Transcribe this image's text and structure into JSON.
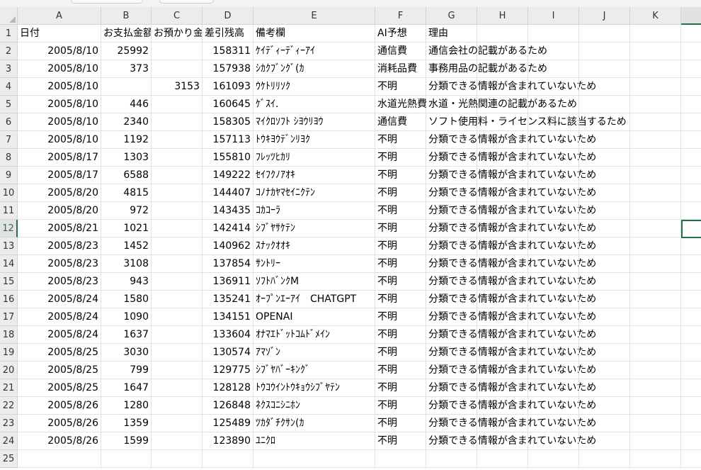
{
  "columns": [
    "A",
    "B",
    "C",
    "D",
    "E",
    "F",
    "G",
    "H",
    "I",
    "J",
    "K"
  ],
  "active_cell": "L12",
  "header_row": {
    "A": "日付",
    "B": "お支払金額",
    "C": "お預かり金額",
    "D": "差引残高",
    "E": "備考欄",
    "F": "AI予想",
    "G": "理由"
  },
  "rows": [
    {
      "a": "2005/8/10",
      "b": "25992",
      "c": "",
      "d": "158311",
      "e": "ｹｲﾃﾞｨｰﾃﾞｨｰｱｲ",
      "f": "通信費",
      "g": "通信会社の記載があるため"
    },
    {
      "a": "2005/8/10",
      "b": "373",
      "c": "",
      "d": "157938",
      "e": "ｼｶｸﾌﾞﾝｸﾞ(ｶ",
      "f": "消耗品費",
      "g": "事務用品の記載があるため"
    },
    {
      "a": "2005/8/10",
      "b": "",
      "c": "3153",
      "d": "161093",
      "e": "ｳｹﾄﾘﾘｿｸ",
      "f": "不明",
      "g": "分類できる情報が含まれていないため"
    },
    {
      "a": "2005/8/10",
      "b": "446",
      "c": "",
      "d": "160645",
      "e": "ｹﾞｽｲ.",
      "f": "水道光熱費",
      "g": "水道・光熱関連の記載があるため"
    },
    {
      "a": "2005/8/10",
      "b": "2340",
      "c": "",
      "d": "158305",
      "e": "ﾏｲｸﾛｿﾌﾄ ｼﾖｳﾘﾖｳ",
      "f": "通信費",
      "g": "ソフト使用料・ライセンス料に該当するため"
    },
    {
      "a": "2005/8/10",
      "b": "1192",
      "c": "",
      "d": "157113",
      "e": "ﾄｳｷﾖｳﾃﾞﾝﾘﾖｸ",
      "f": "不明",
      "g": "分類できる情報が含まれていないため"
    },
    {
      "a": "2005/8/17",
      "b": "1303",
      "c": "",
      "d": "155810",
      "e": "ﾌﾚｯﾂﾋｶﾘ",
      "f": "不明",
      "g": "分類できる情報が含まれていないため"
    },
    {
      "a": "2005/8/17",
      "b": "6588",
      "c": "",
      "d": "149222",
      "e": "ｾｲﾌｸﾉｱｵｷ",
      "f": "不明",
      "g": "分類できる情報が含まれていないため"
    },
    {
      "a": "2005/8/20",
      "b": "4815",
      "c": "",
      "d": "144407",
      "e": "ｺﾉﾅｶﾔﾏｾｲﾆｸﾃﾝ",
      "f": "不明",
      "g": "分類できる情報が含まれていないため"
    },
    {
      "a": "2005/8/20",
      "b": "972",
      "c": "",
      "d": "143435",
      "e": "ｺｶｺｰﾗ",
      "f": "不明",
      "g": "分類できる情報が含まれていないため"
    },
    {
      "a": "2005/8/21",
      "b": "1021",
      "c": "",
      "d": "142414",
      "e": "ｼﾌﾞﾔｻｹﾃﾝ",
      "f": "不明",
      "g": "分類できる情報が含まれていないため"
    },
    {
      "a": "2005/8/23",
      "b": "1452",
      "c": "",
      "d": "140962",
      "e": "ｽﾅｯｸｵｵｷ",
      "f": "不明",
      "g": "分類できる情報が含まれていないため"
    },
    {
      "a": "2005/8/23",
      "b": "3108",
      "c": "",
      "d": "137854",
      "e": "ｻﾝﾄﾘｰ",
      "f": "不明",
      "g": "分類できる情報が含まれていないため"
    },
    {
      "a": "2005/8/23",
      "b": "943",
      "c": "",
      "d": "136911",
      "e": "ｿﾌﾄﾊﾞﾝｸM",
      "f": "不明",
      "g": "分類できる情報が含まれていないため"
    },
    {
      "a": "2005/8/24",
      "b": "1580",
      "c": "",
      "d": "135241",
      "e": "ｵｰﾌﾟﾝｴｰｱｲ　CHATGPT",
      "f": "不明",
      "g": "分類できる情報が含まれていないため"
    },
    {
      "a": "2005/8/24",
      "b": "1090",
      "c": "",
      "d": "134151",
      "e": "OPENAI",
      "f": "不明",
      "g": "分類できる情報が含まれていないため"
    },
    {
      "a": "2005/8/24",
      "b": "1637",
      "c": "",
      "d": "133604",
      "e": "ｵﾅﾏｴﾄﾞｯﾄｺﾑﾄﾞﾒｲﾝ",
      "f": "不明",
      "g": "分類できる情報が含まれていないため"
    },
    {
      "a": "2005/8/25",
      "b": "3030",
      "c": "",
      "d": "130574",
      "e": "ｱﾏｿﾞﾝ",
      "f": "不明",
      "g": "分類できる情報が含まれていないため"
    },
    {
      "a": "2005/8/25",
      "b": "799",
      "c": "",
      "d": "129775",
      "e": "ｼﾌﾞﾔﾊﾞｰｷﾝｸﾞ",
      "f": "不明",
      "g": "分類できる情報が含まれていないため"
    },
    {
      "a": "2005/8/25",
      "b": "1647",
      "c": "",
      "d": "128128",
      "e": "ﾄｳｺｳｲﾝﾄｳｷｮｳｼﾌﾞﾔﾃﾝ",
      "f": "不明",
      "g": "分類できる情報が含まれていないため"
    },
    {
      "a": "2005/8/26",
      "b": "1280",
      "c": "",
      "d": "126848",
      "e": "ﾈｸｽｺﾆｼﾆﾎﾝ",
      "f": "不明",
      "g": "分類できる情報が含まれていないため"
    },
    {
      "a": "2005/8/26",
      "b": "1359",
      "c": "",
      "d": "125489",
      "e": "ﾂｶﾀﾞﾁｸｻﾝ(ｶ",
      "f": "不明",
      "g": "分類できる情報が含まれていないため"
    },
    {
      "a": "2005/8/26",
      "b": "1599",
      "c": "",
      "d": "123890",
      "e": "ﾕﾆｸﾛ",
      "f": "不明",
      "g": "分類できる情報が含まれていないため"
    }
  ]
}
